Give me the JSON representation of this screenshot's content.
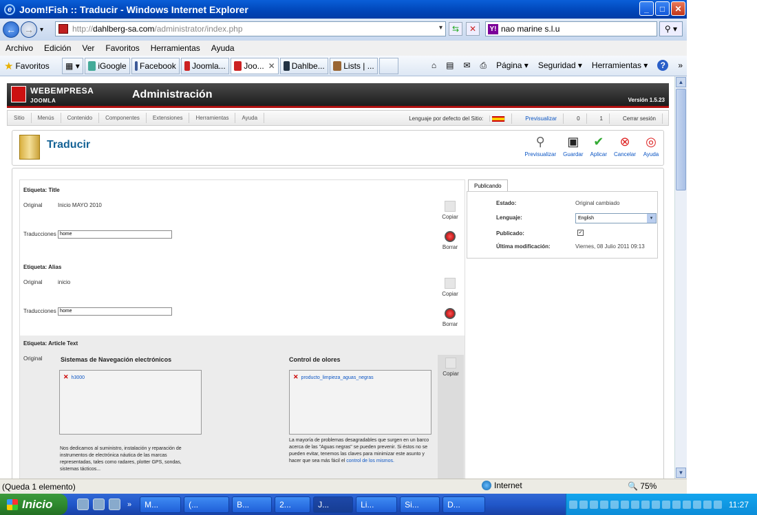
{
  "window": {
    "title": "Joom!Fish :: Traducir - Windows Internet Explorer",
    "ie_glyph": "e",
    "controls": {
      "minimize": "_",
      "maximize": "□",
      "close": "✕"
    }
  },
  "browser": {
    "back_glyph": "←",
    "forward_glyph": "→",
    "dropdown_glyph": "▾",
    "refresh_glyph": "⇆",
    "stop_glyph": "✕",
    "address_prefix": "http://",
    "address_host": "dahlberg-sa.com",
    "address_path": "/administrator/index.php",
    "search_value": "nao marine s.l.u",
    "search_badge": "Y!",
    "search_glyph": "⚲"
  },
  "menubar": [
    "Archivo",
    "Edición",
    "Ver",
    "Favoritos",
    "Herramientas",
    "Ayuda"
  ],
  "favorites": {
    "label": "Favoritos",
    "star": "★",
    "grid_glyph": "▦",
    "close_glyph": "✕",
    "tabs": [
      {
        "label": "iGoogle",
        "color": "#4a9"
      },
      {
        "label": "Facebook",
        "color": "#3b5998"
      },
      {
        "label": "Joomla...",
        "color": "#c22"
      },
      {
        "label": "Joo...",
        "color": "#c22",
        "active": true
      },
      {
        "label": "Dahlbe...",
        "color": "#234"
      },
      {
        "label": "Lists | ...",
        "color": "#963"
      }
    ],
    "commands": [
      "Página ▾",
      "Seguridad ▾",
      "Herramientas ▾"
    ],
    "icons": {
      "home": "⌂",
      "feeds": "▤",
      "mail": "✉",
      "print": "⎙",
      "help": "?",
      "more": "»"
    }
  },
  "joomla": {
    "brand": "WEBEMPRESA",
    "brand_sub": "JOOMLA",
    "title": "Administración",
    "version": "Versión 1.5.23",
    "menu": [
      "Sitio",
      "Menús",
      "Contenido",
      "Componentes",
      "Extensiones",
      "Herramientas",
      "Ayuda"
    ],
    "status": {
      "language": "Lenguaje por defecto del Sitio:",
      "preview": "Previsualizar",
      "messages": "0",
      "users": "1",
      "logout": "Cerrar sesión"
    },
    "page_title": "Traducir",
    "toolbar": [
      {
        "label": "Previsualizar",
        "icon": "magnifier-icon",
        "glyph": "⚲",
        "color": "#666"
      },
      {
        "label": "Guardar",
        "icon": "save-icon",
        "glyph": "▣",
        "color": "#222"
      },
      {
        "label": "Aplicar",
        "icon": "checkmark-icon",
        "glyph": "✔",
        "color": "#3a3"
      },
      {
        "label": "Cancelar",
        "icon": "cancel-icon",
        "glyph": "⊗",
        "color": "#d22"
      },
      {
        "label": "Ayuda",
        "icon": "lifebuoy-icon",
        "glyph": "◎",
        "color": "#d22"
      }
    ]
  },
  "translation": {
    "field_title": {
      "label": "Etiqueta: Title",
      "original_label": "Original",
      "original": "Inicio MAYO 2010",
      "translation_label": "Traducciones",
      "translation": "home"
    },
    "field_alias": {
      "label": "Etiqueta: Alias",
      "original_label": "Original",
      "original": "inicio",
      "translation_label": "Traducciones",
      "translation": "home"
    },
    "field_article": {
      "label": "Etiqueta: Article Text",
      "original_label": "Original",
      "col1_heading": "Sistemas de Navegación electrónicos",
      "col1_image": "h3000",
      "col1_text": "Nos dedicamos al suministro, instalación y reparación de instrumentos de electrónica náutica de las marcas representadas, tales como radares, plotter GPS, sondas, sistemas tácticos...",
      "col2_heading": "Control de olores",
      "col2_image": "producto_limpieza_aguas_negras",
      "col2_text": "La mayoría de problemas desagradables que surgen en un barco acerca de las \"Aguas negras\" se pueden prevenir. Si éstos no se pueden evitar, tenemos las claves para minimizar este asunto y hacer que sea más fácil el",
      "col2_link": "control de los mismos."
    },
    "copy_label": "Copiar",
    "delete_label": "Borrar",
    "broken_glyph": "✕"
  },
  "publishing": {
    "tab": "Publicando",
    "state_label": "Estado:",
    "state_value": "Original cambiado",
    "language_label": "Lenguaje:",
    "language_value": "English",
    "published_label": "Publicado:",
    "published_glyph": "✓",
    "modified_label": "Última modificación:",
    "modified_value": "Viernes, 08 Julio 2011 09:13"
  },
  "statusbar": {
    "text": "(Queda 1 elemento)",
    "zone": "Internet",
    "zoom": "🔍 75%"
  },
  "taskbar": {
    "start": "Inicio",
    "more_glyph": "»",
    "tasks": [
      "M...",
      "(...",
      "B...",
      "2...",
      "J...",
      "Li...",
      "Si...",
      "D..."
    ],
    "active_task": 4,
    "clock": "11:27"
  },
  "colors": {
    "accent_red": "#b01010",
    "link_blue": "#0b55c4",
    "title_blue": "#146295"
  }
}
